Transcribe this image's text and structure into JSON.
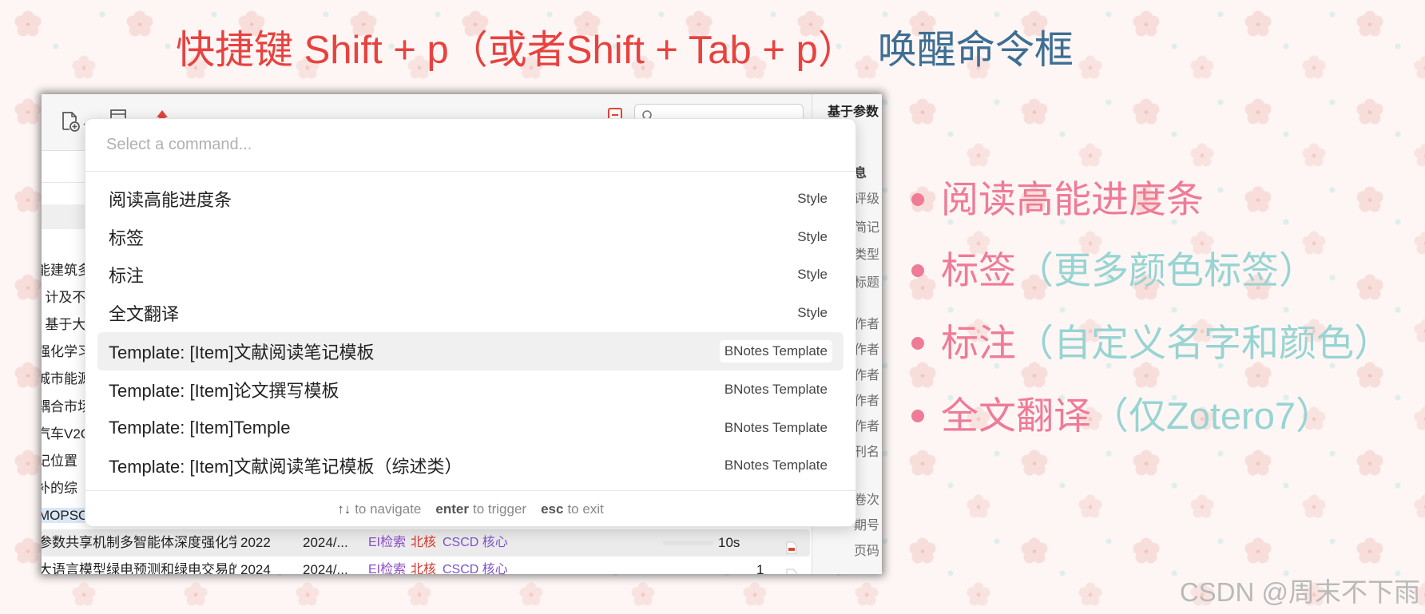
{
  "colors": {
    "title_red": "#e8423f",
    "title_blue": "#3e6e93",
    "feature_pink": "#ef7b97",
    "feature_teal": "#97d4d2",
    "tag_ei": "#8a4cc6",
    "tag_beihe": "#d9352c",
    "tag_cscd": "#7b52cc"
  },
  "title": {
    "main": "快捷键 Shift + p（或者Shift + Tab + p）",
    "suffix": "唤醒命令框"
  },
  "zotero": {
    "item_pane": {
      "title": "基于参数",
      "section": "息",
      "labels": [
        "评级",
        "简记",
        "类型",
        "标题",
        "作者",
        "作者",
        "作者",
        "作者",
        "作者",
        "刊名",
        "卷次",
        "期号",
        "页码"
      ]
    },
    "list_fragments": [
      "能建筑多",
      "- 计及不",
      "- 基于大",
      "强化学习",
      "城市能源",
      "耦合市场",
      "汽车V2G",
      "记位置",
      "补的综",
      "MOPSO:"
    ],
    "rows": [
      {
        "title": "参数共享机制多智能体深度强化学",
        "year": "2022",
        "date": "2024/...",
        "tags": [
          "EI检索",
          "北核",
          "CSCD 核心"
        ],
        "extra": "10s"
      },
      {
        "title": "大语言模型绿电预测和绿电交易的",
        "year": "2024",
        "date": "2024/...",
        "tags": [
          "EI检索",
          "北核",
          "CSCD 核心"
        ],
        "extra": "1"
      }
    ]
  },
  "palette": {
    "placeholder": "Select a command...",
    "items": [
      {
        "label": "阅读高能进度条",
        "category": "Style"
      },
      {
        "label": "标签",
        "category": "Style"
      },
      {
        "label": "标注",
        "category": "Style"
      },
      {
        "label": "全文翻译",
        "category": "Style"
      },
      {
        "label": "Template: [Item]文献阅读笔记模板",
        "category": "BNotes Template"
      },
      {
        "label": "Template: [Item]论文撰写模板",
        "category": "BNotes Template"
      },
      {
        "label": "Template: [Item]Temple",
        "category": "BNotes Template"
      },
      {
        "label": "Template: [Item]文献阅读笔记模板（综述类）",
        "category": "BNotes Template"
      }
    ],
    "footer": [
      {
        "key": "↑↓",
        "text": "to navigate"
      },
      {
        "key": "enter",
        "text": "to trigger"
      },
      {
        "key": "esc",
        "text": "to exit"
      }
    ]
  },
  "features": [
    {
      "main": "阅读高能进度条",
      "note": ""
    },
    {
      "main": "标签",
      "note": "（更多颜色标签）"
    },
    {
      "main": "标注",
      "note": "（自定义名字和颜色）"
    },
    {
      "main": "全文翻译",
      "note": "（仅Zotero7）"
    }
  ],
  "watermark": "CSDN @周末不下雨"
}
